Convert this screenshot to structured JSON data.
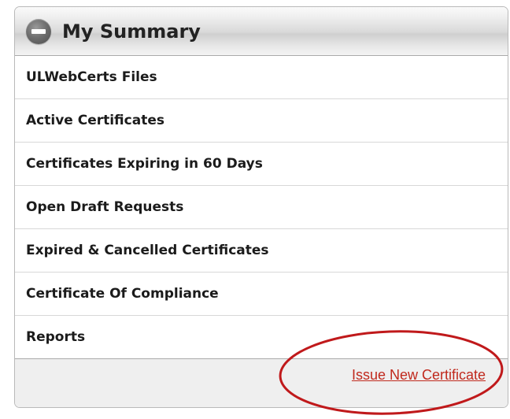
{
  "summary_panel": {
    "title": "My Summary",
    "items": [
      {
        "label": "ULWebCerts Files"
      },
      {
        "label": "Active Certificates"
      },
      {
        "label": "Certificates Expiring in 60 Days"
      },
      {
        "label": "Open Draft Requests"
      },
      {
        "label": "Expired & Cancelled Certificates"
      },
      {
        "label": "Certificate Of Compliance"
      },
      {
        "label": "Reports"
      }
    ],
    "footer_link": "Issue New Certificate"
  },
  "annotation": {
    "ellipse_color": "#c0191b"
  },
  "colors": {
    "link": "#c0291d",
    "text": "#1b1b1b"
  }
}
